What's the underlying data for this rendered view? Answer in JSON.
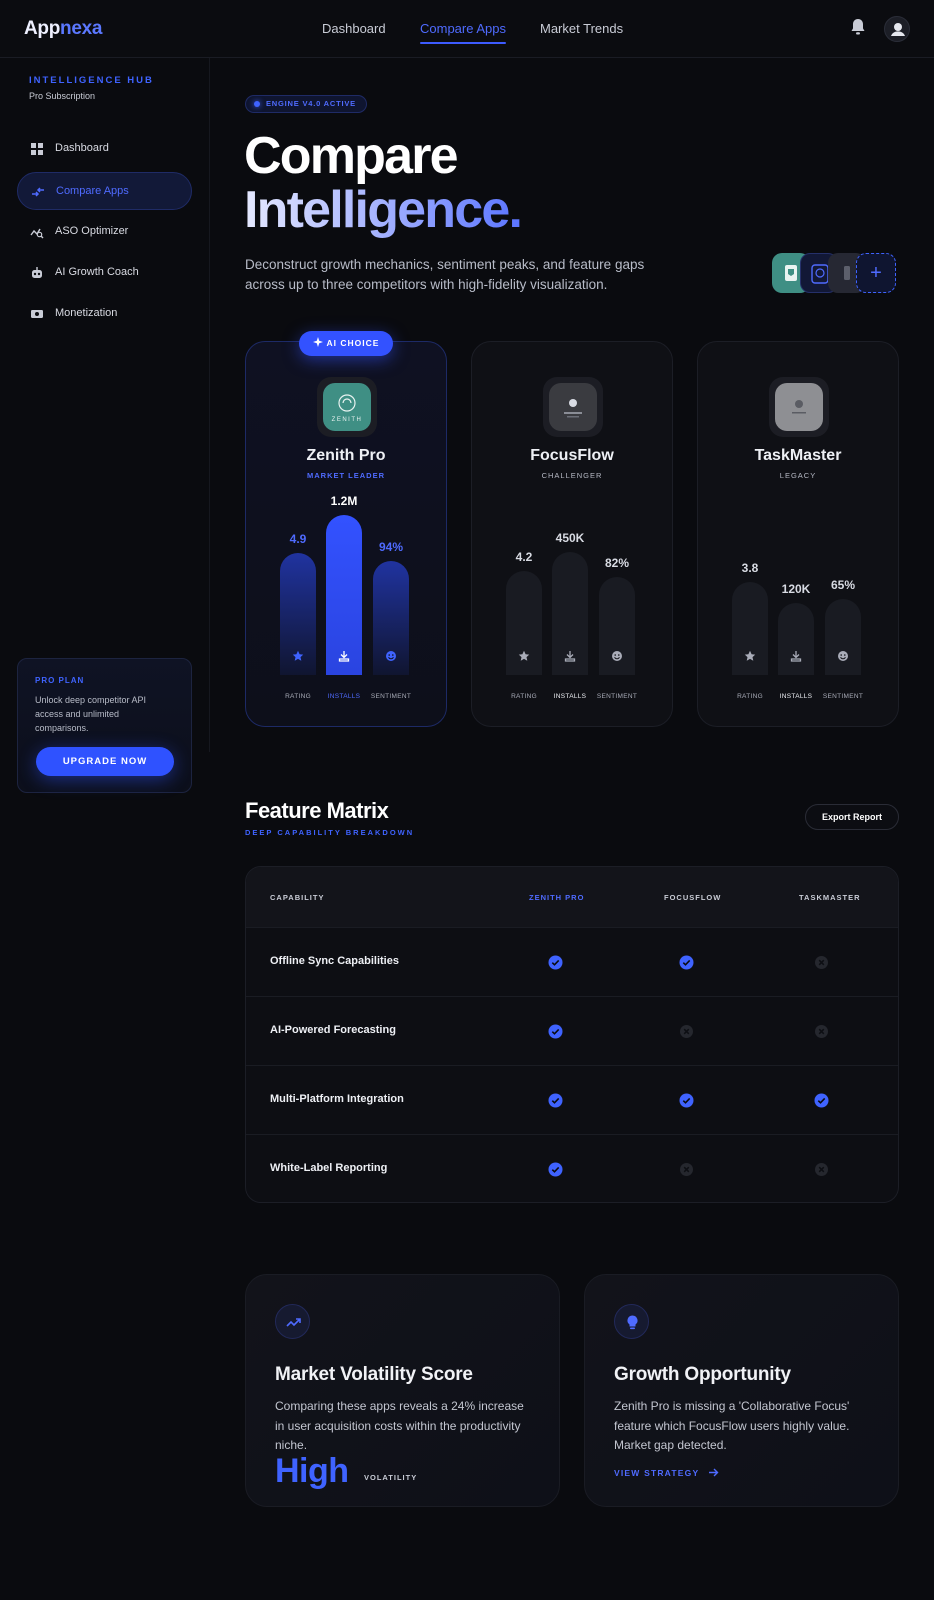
{
  "brand": {
    "part1": "App",
    "part2": "nexa"
  },
  "topnav": {
    "links": [
      "Dashboard",
      "Compare Apps",
      "Market Trends"
    ],
    "active": "Compare Apps",
    "icons": [
      "bell-icon",
      "user-icon"
    ]
  },
  "sidebar": {
    "title": "INTELLIGENCE HUB",
    "subtitle": "Pro Subscription",
    "items": [
      {
        "label": "Dashboard",
        "icon": "grid-icon"
      },
      {
        "label": "Compare Apps",
        "icon": "compare-icon",
        "active": true
      },
      {
        "label": "ASO Optimizer",
        "icon": "chart-search-icon"
      },
      {
        "label": "AI Growth Coach",
        "icon": "robot-icon"
      },
      {
        "label": "Monetization",
        "icon": "money-icon"
      }
    ],
    "pro": {
      "title": "PRO PLAN",
      "desc": "Unlock deep competitor API access and unlimited comparisons.",
      "button": "UPGRADE NOW"
    }
  },
  "hero": {
    "pill": "ENGINE V4.0 ACTIVE",
    "title_line1": "Compare",
    "title_line2": "Intelligence.",
    "desc": "Deconstruct growth mechanics, sentiment peaks, and feature gaps across up to three competitors with high-fidelity visualization.",
    "add_label": "+"
  },
  "apps": [
    {
      "name": "Zenith Pro",
      "tag": "MARKET LEADER",
      "badge": "AI CHOICE",
      "icon_text": "ZENITH",
      "metrics": {
        "rating": 4.9,
        "installs": "1.2M",
        "installs_num": 1200000,
        "sentiment": "94%"
      }
    },
    {
      "name": "FocusFlow",
      "tag": "CHALLENGER",
      "metrics": {
        "rating": 4.2,
        "installs": "450K",
        "installs_num": 450000,
        "sentiment": "82%"
      }
    },
    {
      "name": "TaskMaster",
      "tag": "LEGACY",
      "metrics": {
        "rating": 3.8,
        "installs": "120K",
        "installs_num": 120000,
        "sentiment": "65%"
      }
    }
  ],
  "metric_labels": {
    "rating": "RATING",
    "installs": "INSTALLS",
    "sentiment": "SENTIMENT"
  },
  "matrix": {
    "title": "Feature Matrix",
    "subtitle": "DEEP CAPABILITY BREAKDOWN",
    "export": "Export Report",
    "headers": [
      "CAPABILITY",
      "ZENITH PRO",
      "FOCUSFLOW",
      "TASKMASTER"
    ],
    "rows": [
      {
        "feature": "Offline Sync Capabilities",
        "values": [
          true,
          true,
          false
        ]
      },
      {
        "feature": "AI-Powered Forecasting",
        "values": [
          true,
          false,
          false
        ]
      },
      {
        "feature": "Multi-Platform Integration",
        "values": [
          true,
          true,
          true
        ]
      },
      {
        "feature": "White-Label Reporting",
        "values": [
          true,
          false,
          false
        ]
      }
    ]
  },
  "insights": {
    "volatility": {
      "title": "Market Volatility Score",
      "desc": "Comparing these apps reveals a 24% increase in user acquisition costs within the productivity niche.",
      "value": "High",
      "value_label": "VOLATILITY",
      "icon": "trending-up-icon"
    },
    "growth": {
      "title": "Growth Opportunity",
      "desc": "Zenith Pro is missing a 'Collaborative Focus' feature which FocusFlow users highly value. Market gap detected.",
      "link": "VIEW STRATEGY",
      "icon": "lightbulb-icon"
    }
  },
  "colors": {
    "accent": "#3f63ff",
    "bg": "#0a0b0f",
    "card": "#0f1015",
    "zenith": "#3f8f84"
  }
}
